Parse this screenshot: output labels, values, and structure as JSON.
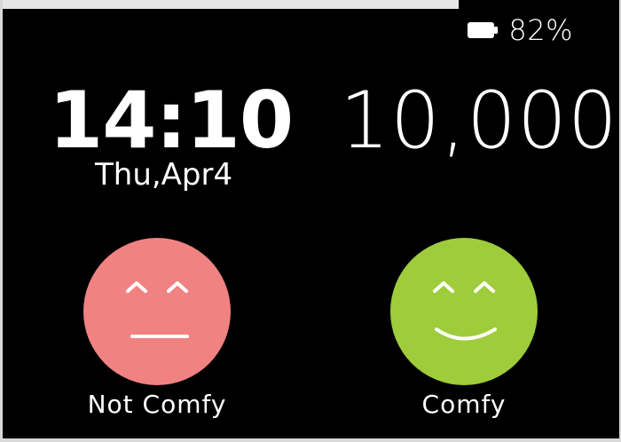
{
  "status": {
    "battery_icon": "battery-icon",
    "battery_level": "82%"
  },
  "clock": {
    "time": "14:10",
    "date": "Thu,Apr4"
  },
  "steps": {
    "count": "10,000"
  },
  "choices": [
    {
      "label": "Not Comfy",
      "color": "#f08282",
      "icon": "neutral-face-icon"
    },
    {
      "label": "Comfy",
      "color": "#9fcc3b",
      "icon": "smiling-face-icon"
    }
  ]
}
